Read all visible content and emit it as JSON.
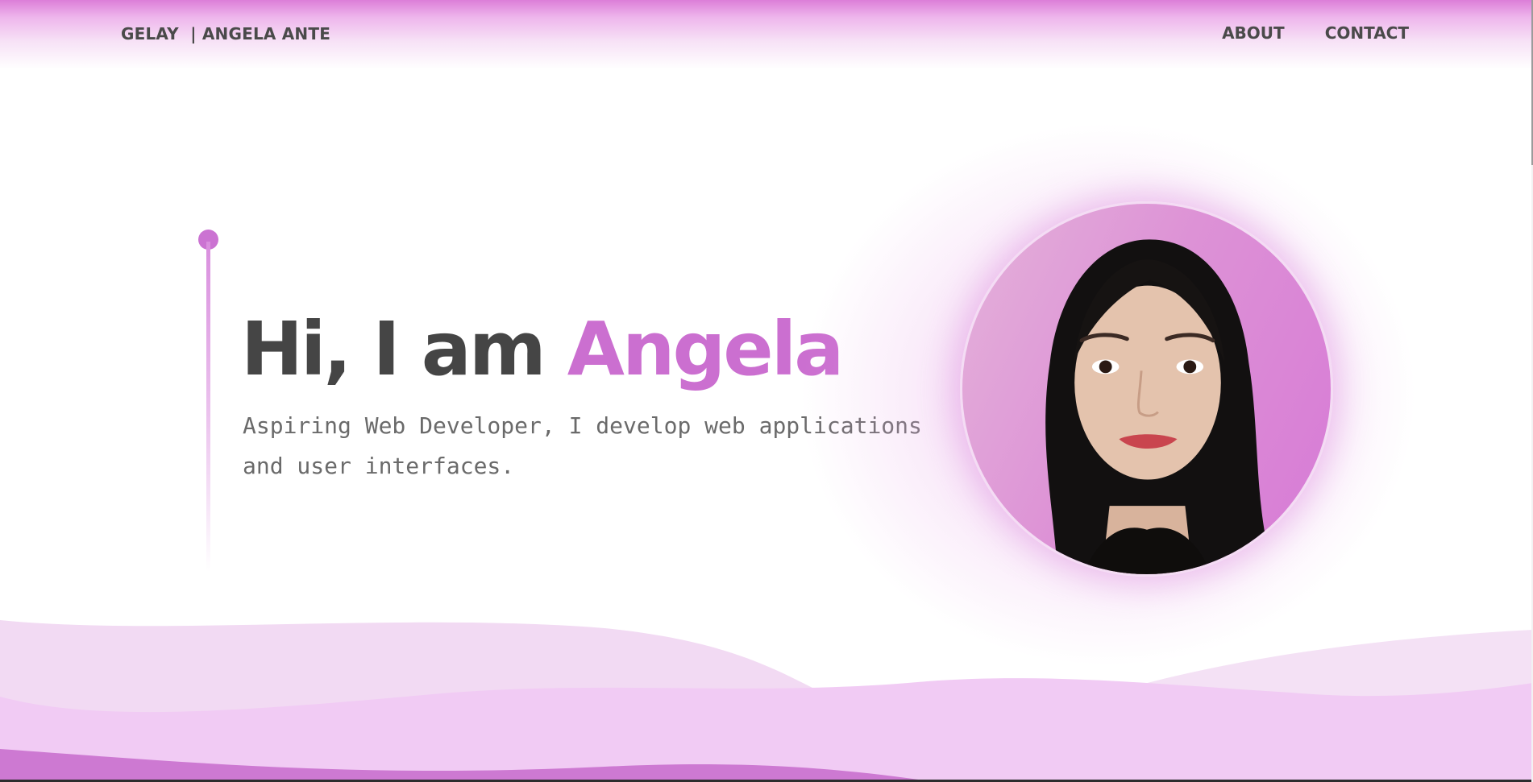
{
  "header": {
    "brand": "GELAY  | ANGELA ANTE",
    "nav": [
      {
        "label": "ABOUT"
      },
      {
        "label": "CONTACT"
      }
    ]
  },
  "hero": {
    "title_prefix": "Hi, I am ",
    "title_name": "Angela",
    "subtitle": "Aspiring Web Developer, I develop web applications and user interfaces."
  },
  "colors": {
    "accent": "#cb6fd0",
    "text_dark": "#454545",
    "text_muted": "#6a6a6a",
    "wave_light": "#f2daf3",
    "wave_mid": "#f1cbf4",
    "wave_dark": "#cd79d2"
  }
}
